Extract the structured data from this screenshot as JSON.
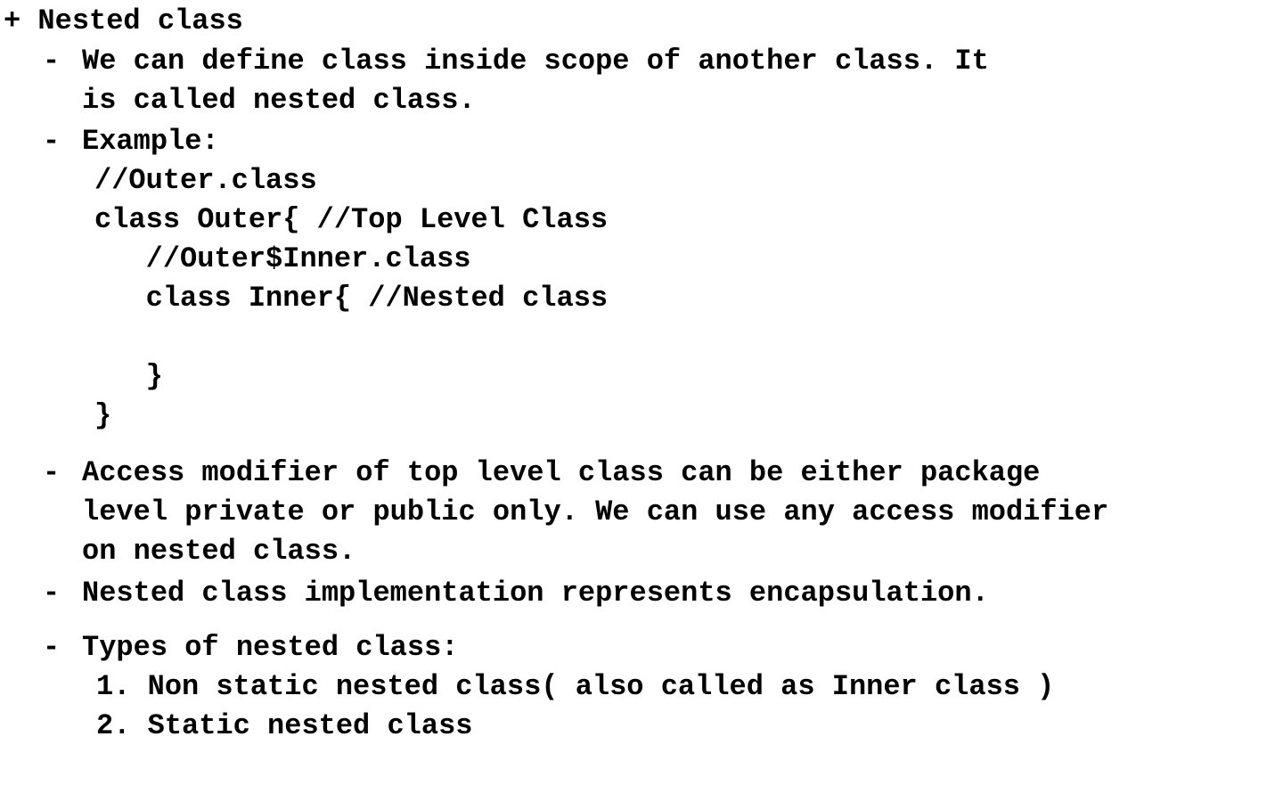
{
  "heading": "+ Nested class",
  "bullets": {
    "definition": {
      "marker": "-",
      "lines": [
        "We can define class inside scope of another class. It",
        "is called nested class."
      ]
    },
    "example": {
      "marker": "-",
      "label": "Example:",
      "code": [
        "//Outer.class",
        "class Outer{ //Top Level Class",
        "   //Outer$Inner.class",
        "   class Inner{ //Nested class",
        "",
        "   }",
        "}"
      ]
    },
    "access": {
      "marker": "-",
      "lines": [
        "Access modifier of top level class can be either package",
        "level private or public only. We can use any access modifier",
        "on nested class."
      ]
    },
    "encapsulation": {
      "marker": "-",
      "lines": [
        "Nested class implementation represents encapsulation."
      ]
    },
    "types": {
      "marker": "-",
      "label": "Types of nested class:",
      "items": [
        "1. Non static nested class( also called as Inner class )",
        "2. Static nested class"
      ]
    }
  }
}
